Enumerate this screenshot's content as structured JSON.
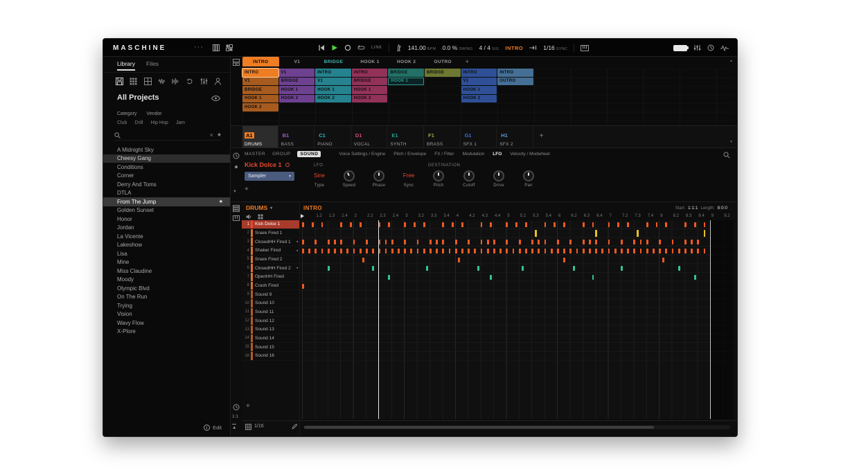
{
  "app": {
    "title": "MASCHINE"
  },
  "glyphs": {
    "menu_dots": "···",
    "caret_down": "▾",
    "star": "★",
    "close": "×",
    "plus": "+",
    "chevron_up": "▲",
    "chevron_down": "▼",
    "badge": "◂",
    "up_arrow": "▲"
  },
  "transport": {
    "link": "LINK",
    "bpm": "141.00",
    "bpm_label": "BPM",
    "swing": "0.0 %",
    "swing_label": "SWING",
    "sig": "4 / 4",
    "sig_label": "SIG",
    "section": "INTRO",
    "follow": "1/16",
    "follow_label": "SYNC"
  },
  "browser": {
    "tabs": [
      {
        "label": "Library"
      },
      {
        "label": "Files"
      }
    ],
    "title": "All Projects",
    "filter_labels": [
      "Category",
      "Vendor"
    ],
    "tags": [
      "Club",
      "Drill",
      "Hip Hop",
      "Jam"
    ],
    "search_placeholder": "",
    "edit_label": "Edit",
    "projects": [
      {
        "name": "A Midnight Sky"
      },
      {
        "name": "Cheesy Gang",
        "highlight": true
      },
      {
        "name": "Conditions"
      },
      {
        "name": "Corner"
      },
      {
        "name": "Derry And Toms"
      },
      {
        "name": "DTLA"
      },
      {
        "name": "From The Jump",
        "selected": true,
        "starred": true
      },
      {
        "name": "Golden Sunset"
      },
      {
        "name": "Honor"
      },
      {
        "name": "Jordan"
      },
      {
        "name": "La Vicente"
      },
      {
        "name": "Lakeshow"
      },
      {
        "name": "Lisa"
      },
      {
        "name": "Mine"
      },
      {
        "name": "Miss Claudine"
      },
      {
        "name": "Moody"
      },
      {
        "name": "Olympic Blvd"
      },
      {
        "name": "On The Run"
      },
      {
        "name": "Trying"
      },
      {
        "name": "Vision"
      },
      {
        "name": "Wavy Flow"
      },
      {
        "name": "X-Plore"
      }
    ]
  },
  "arranger": {
    "scenes": [
      {
        "label": "INTRO",
        "active": true,
        "color": "#ef7d23"
      },
      {
        "label": "V1"
      },
      {
        "label": "BRIDGE",
        "color": "#3fb8b0"
      },
      {
        "label": "HOOK 1"
      },
      {
        "label": "HOOK 2"
      },
      {
        "label": "OUTRO"
      }
    ],
    "groups": [
      {
        "id": "A1",
        "name": "DRUMS",
        "color": "#ef7d23",
        "selected": true,
        "clips": [
          {
            "label": "INTRO",
            "selected": true
          },
          {
            "label": "V1"
          },
          {
            "label": "BRIDGE"
          },
          {
            "label": "HOOK 1"
          },
          {
            "label": "HOOK 2"
          }
        ]
      },
      {
        "id": "B1",
        "name": "BASS",
        "color": "#9b59d0",
        "clips": [
          {
            "label": "V1"
          },
          {
            "label": "BRIDGE"
          },
          {
            "label": "HOOK 1"
          },
          {
            "label": "HOOK 2"
          }
        ]
      },
      {
        "id": "C1",
        "name": "PIANO",
        "color": "#2ab7c9",
        "clips": [
          {
            "label": "INTRO"
          },
          {
            "label": "V1"
          },
          {
            "label": "HOOK 1"
          },
          {
            "label": "HOOK 2"
          }
        ]
      },
      {
        "id": "D1",
        "name": "VOCAL",
        "color": "#d4427e",
        "clips": [
          {
            "label": "INTRO"
          },
          {
            "label": "BRIDGE"
          },
          {
            "label": "HOOK 1"
          },
          {
            "label": "HOOK 2"
          }
        ]
      },
      {
        "id": "E1",
        "name": "SYNTH",
        "color": "#2a9d8f",
        "clips": [
          {
            "label": "BRIDGE"
          },
          {
            "label": "HOOK 1",
            "variant": "outline"
          }
        ]
      },
      {
        "id": "F1",
        "name": "BRASS",
        "color": "#97a83e",
        "clips": [
          {
            "label": "BRIDGE"
          }
        ]
      },
      {
        "id": "G1",
        "name": "SFX 1",
        "color": "#3d6fd9",
        "clips": [
          {
            "label": "INTRO"
          },
          {
            "label": "V1"
          },
          {
            "label": "HOOK 1"
          },
          {
            "label": "HOOK 2"
          }
        ]
      },
      {
        "id": "H1",
        "name": "SFX 2",
        "color": "#5b9bd5",
        "clips": [
          {
            "label": "INTRO"
          },
          {
            "label": "OUTRO"
          }
        ]
      }
    ]
  },
  "control": {
    "levels": [
      {
        "label": "MASTER"
      },
      {
        "label": "GROUP"
      },
      {
        "label": "SOUND",
        "active": true
      }
    ],
    "tabs": [
      {
        "label": "Voice Settings / Engine"
      },
      {
        "label": "Pitch / Envelope"
      },
      {
        "label": "FX / Filter"
      },
      {
        "label": "Modulation"
      },
      {
        "label": "LFO",
        "active": true
      },
      {
        "label": "Velocity / Modwheel"
      }
    ],
    "sound_name": "Kick Dolce 1",
    "engine": "Sampler",
    "section": "LFO",
    "destination": "DESTINATION",
    "params": [
      {
        "label": "Type",
        "value": "Sine",
        "kind": "select"
      },
      {
        "label": "Speed",
        "kind": "knob",
        "angle": -25
      },
      {
        "label": "Phase",
        "kind": "knob",
        "angle": 0
      },
      {
        "label": "Sync",
        "value": "Free",
        "kind": "select"
      },
      {
        "label": "Pitch",
        "kind": "knob",
        "angle": 0
      },
      {
        "label": "Cutoff",
        "kind": "knob",
        "angle": 0
      },
      {
        "label": "Drive",
        "kind": "knob",
        "angle": 0
      },
      {
        "label": "Pan",
        "kind": "knob",
        "angle": 0
      }
    ]
  },
  "pattern": {
    "group": "DRUMS",
    "name": "INTRO",
    "start_label": "Start:",
    "start": "1:1:1",
    "length_label": "Length:",
    "length": "8:0:0",
    "grid": "1/16",
    "pos_label": "1:1",
    "sounds": [
      {
        "num": "1",
        "name": "Kick Dolce 1",
        "color": "#e8472e",
        "selected": true
      },
      {
        "num": "2",
        "name": "Snare Fired 1",
        "color": "#e2702a"
      },
      {
        "num": "3",
        "name": "ClosedHH Fired 1",
        "color": "#e2702a",
        "badge": true
      },
      {
        "num": "4",
        "name": "Shaker Fired",
        "color": "#e2702a",
        "badge": true
      },
      {
        "num": "5",
        "name": "Snare Fired 2",
        "color": "#e2702a"
      },
      {
        "num": "6",
        "name": "ClosedHH Fired 2",
        "color": "#e2702a",
        "badge": true
      },
      {
        "num": "7",
        "name": "OpenHH Fired",
        "color": "#e2702a"
      },
      {
        "num": "8",
        "name": "Crash Fired",
        "color": "#e2702a"
      },
      {
        "num": "9",
        "name": "Sound 9",
        "color": "#b85a24"
      },
      {
        "num": "10",
        "name": "Sound 10",
        "color": "#b85a24"
      },
      {
        "num": "11",
        "name": "Sound 11",
        "color": "#b85a24"
      },
      {
        "num": "12",
        "name": "Sound 12",
        "color": "#b85a24"
      },
      {
        "num": "13",
        "name": "Sound 13",
        "color": "#b85a24"
      },
      {
        "num": "14",
        "name": "Sound 14",
        "color": "#b85a24"
      },
      {
        "num": "15",
        "name": "Sound 15",
        "color": "#b85a24"
      },
      {
        "num": "16",
        "name": "Sound 16",
        "color": "#b85a24"
      }
    ],
    "bars": 8,
    "playhead_beat": 6,
    "ruler_labels": [
      "1.2",
      "1.3",
      "1.4",
      "2",
      "2.2",
      "2.3",
      "2.4",
      "3",
      "3.2",
      "3.3",
      "3.4",
      "4",
      "4.2",
      "4.3",
      "4.4",
      "5",
      "5.2",
      "5.3",
      "5.4",
      "6",
      "6.2",
      "6.3",
      "6.4",
      "7",
      "7.2",
      "7.3",
      "7.4",
      "8",
      "8.2",
      "8.3",
      "8.4",
      "9",
      "9.2"
    ],
    "notes": [
      {
        "row": 1,
        "color": "#f05a22",
        "beats": [
          0,
          0.75,
          1.5,
          3,
          3.75,
          4.5,
          6,
          6.75,
          8,
          8.75,
          9.5,
          11,
          11.75,
          12.5,
          14,
          14.75,
          16,
          16.75,
          17.5,
          19,
          19.75,
          20.5,
          22,
          22.75,
          24,
          24.75,
          25.5,
          27,
          27.75,
          28.5,
          30,
          30.75,
          31.5
        ]
      },
      {
        "row": 2,
        "color": "#e6c226",
        "tall": true,
        "beats": [
          18.25,
          23,
          26.25,
          31.5
        ]
      },
      {
        "row": 3,
        "color": "#f05a22",
        "beats": [
          0,
          1,
          2,
          2.5,
          3,
          4,
          5,
          6,
          6.5,
          7,
          8,
          9,
          10,
          10.5,
          11,
          12,
          13,
          14,
          14.5,
          15,
          16,
          17,
          18,
          18.5,
          19,
          20,
          21,
          22,
          22.5,
          23,
          24,
          25,
          26,
          26.5,
          27,
          28,
          29,
          30,
          30.5,
          31
        ]
      },
      {
        "row": 4,
        "color": "#f05a22",
        "beats": [
          0,
          0.5,
          1,
          1.5,
          2,
          2.5,
          3,
          3.5,
          4,
          4.5,
          5,
          5.5,
          6,
          6.5,
          7,
          7.5,
          8,
          8.5,
          9,
          9.5,
          10,
          10.5,
          11,
          11.5,
          12,
          12.5,
          13,
          13.5,
          14,
          14.5,
          15,
          15.5,
          16,
          16.5,
          17,
          17.5,
          18,
          18.5,
          19,
          19.5,
          20,
          20.5,
          21,
          21.5,
          22,
          22.5,
          23,
          23.5,
          24,
          24.5,
          25,
          25.5,
          26,
          26.5,
          27,
          27.5,
          28,
          28.5,
          29,
          29.5,
          30,
          30.5,
          31,
          31.5
        ]
      },
      {
        "row": 5,
        "color": "#f05a22",
        "beats": [
          4.75,
          12.25,
          20.5,
          28.25
        ]
      },
      {
        "row": 6,
        "color": "#35c48e",
        "beats": [
          2,
          5.5,
          9.75,
          13.75,
          17.25,
          21.25,
          25,
          29.5
        ]
      },
      {
        "row": 7,
        "color": "#35c48e",
        "beats": [
          6.75,
          14.75,
          22.75,
          30.75
        ]
      },
      {
        "row": 8,
        "color": "#f05a22",
        "beats": [
          0
        ]
      }
    ]
  }
}
